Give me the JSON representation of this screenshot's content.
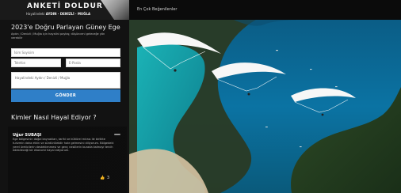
{
  "top_nav": {
    "link": "En Çok Beğenilenler"
  },
  "logo": {
    "title": "ANKETİ DOLDUR",
    "sub_prefix": "Hayalindeki",
    "sub_highlight": "AYDIN · DENİZLİ · MUĞLA"
  },
  "survey": {
    "title": "2023'e Doğru Parlayan Güney Ege",
    "description": "Aydın / Denizli / Muğla için hayalini paylaş; düşünceni geleceğe yön verebilir"
  },
  "form": {
    "name_placeholder": "İsim Soyisim",
    "phone_placeholder": "Telefon",
    "email_placeholder": "E-Posta",
    "city_placeholder": "Hayalindeki Aydın / Denizli / Muğla",
    "submit_label": "GÖNDER"
  },
  "dreams": {
    "title": "Kimler Nasıl Hayal Ediyor ?",
    "story": {
      "name": "Uğur SUBAŞI",
      "text": "Ege bölgesinin doğal kaynakları, tarihi ve kültürel mirası ile birlikte turizmin daha etkin ve sürdürülebilir hale gelmesini diliyorum. Bölgedeki yerel üreticilerin desteklenmesi ve genç nesillerin burada kalmayı tercih edebileceği bir ekonomi hayal ediyorum.",
      "likes": "3"
    }
  }
}
